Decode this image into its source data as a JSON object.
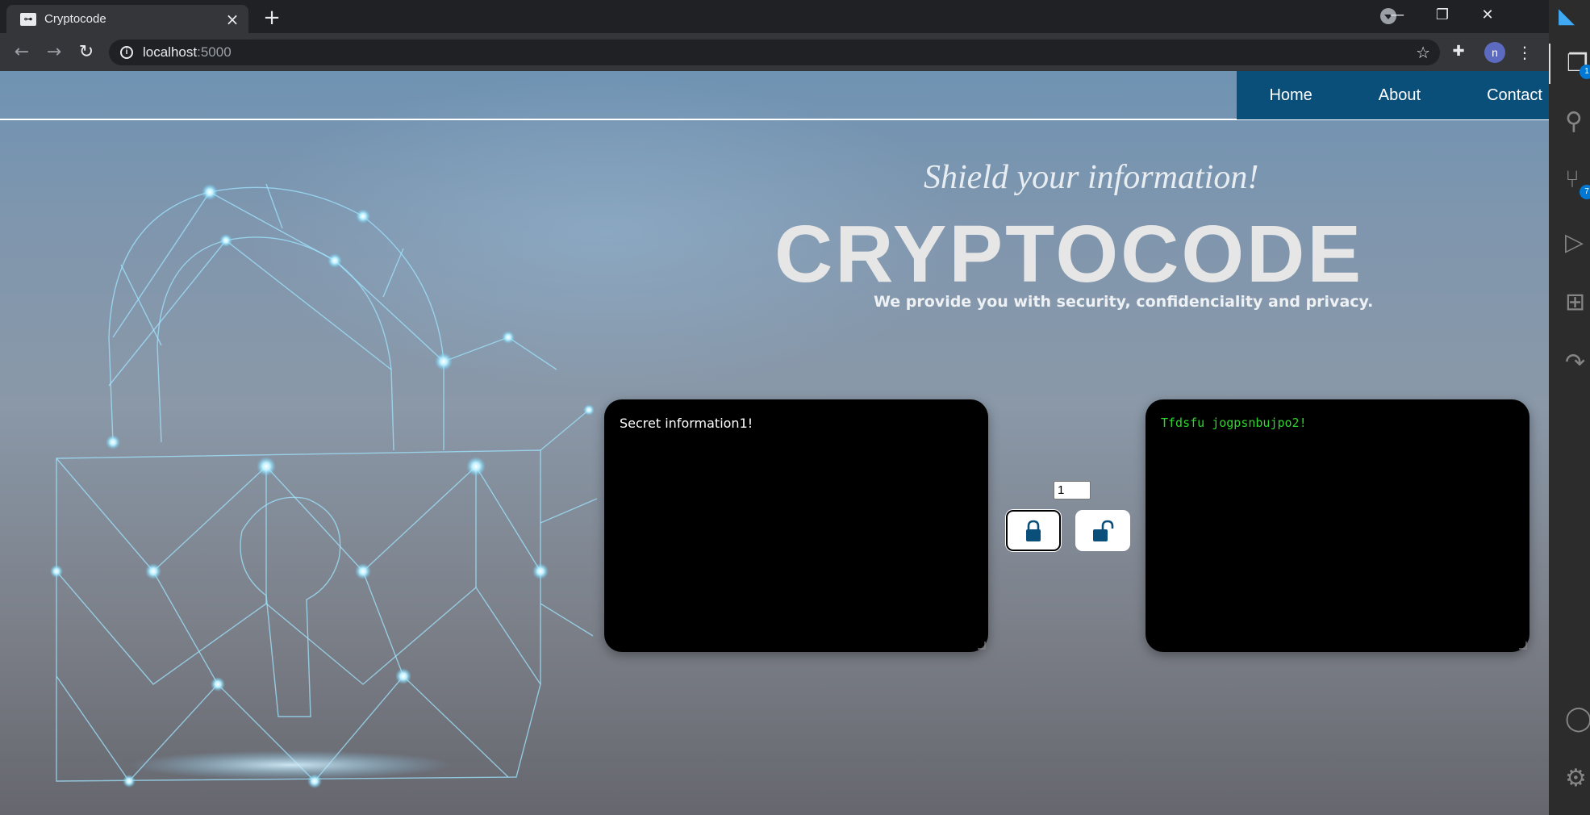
{
  "browser": {
    "tab_title": "Cryptocode",
    "tab_favicon": "key-icon",
    "url_host": "localhost",
    "url_port": ":5000",
    "profile_initial": "n"
  },
  "vscode": {
    "explorer_badge": "1",
    "source_control_badge": "7"
  },
  "nav": {
    "home": "Home",
    "about": "About",
    "contact": "Contact"
  },
  "hero": {
    "tagline": "Shield your information!",
    "brand": "CRYPTOCODE",
    "subtitle": "We provide you with security, confidenciality and privacy."
  },
  "cipher_tool": {
    "plain_text": "Secret information1!",
    "key_value": "1",
    "encrypted_text": "Tfdsfu jogpsnbujpo2!",
    "encrypt_icon": "lock-closed-icon",
    "decrypt_icon": "lock-open-icon"
  },
  "colors": {
    "nav_bg": "#0a4f7a",
    "cipher_text": "#2fd42f",
    "lock_button_icon": "#0a4f7a"
  }
}
